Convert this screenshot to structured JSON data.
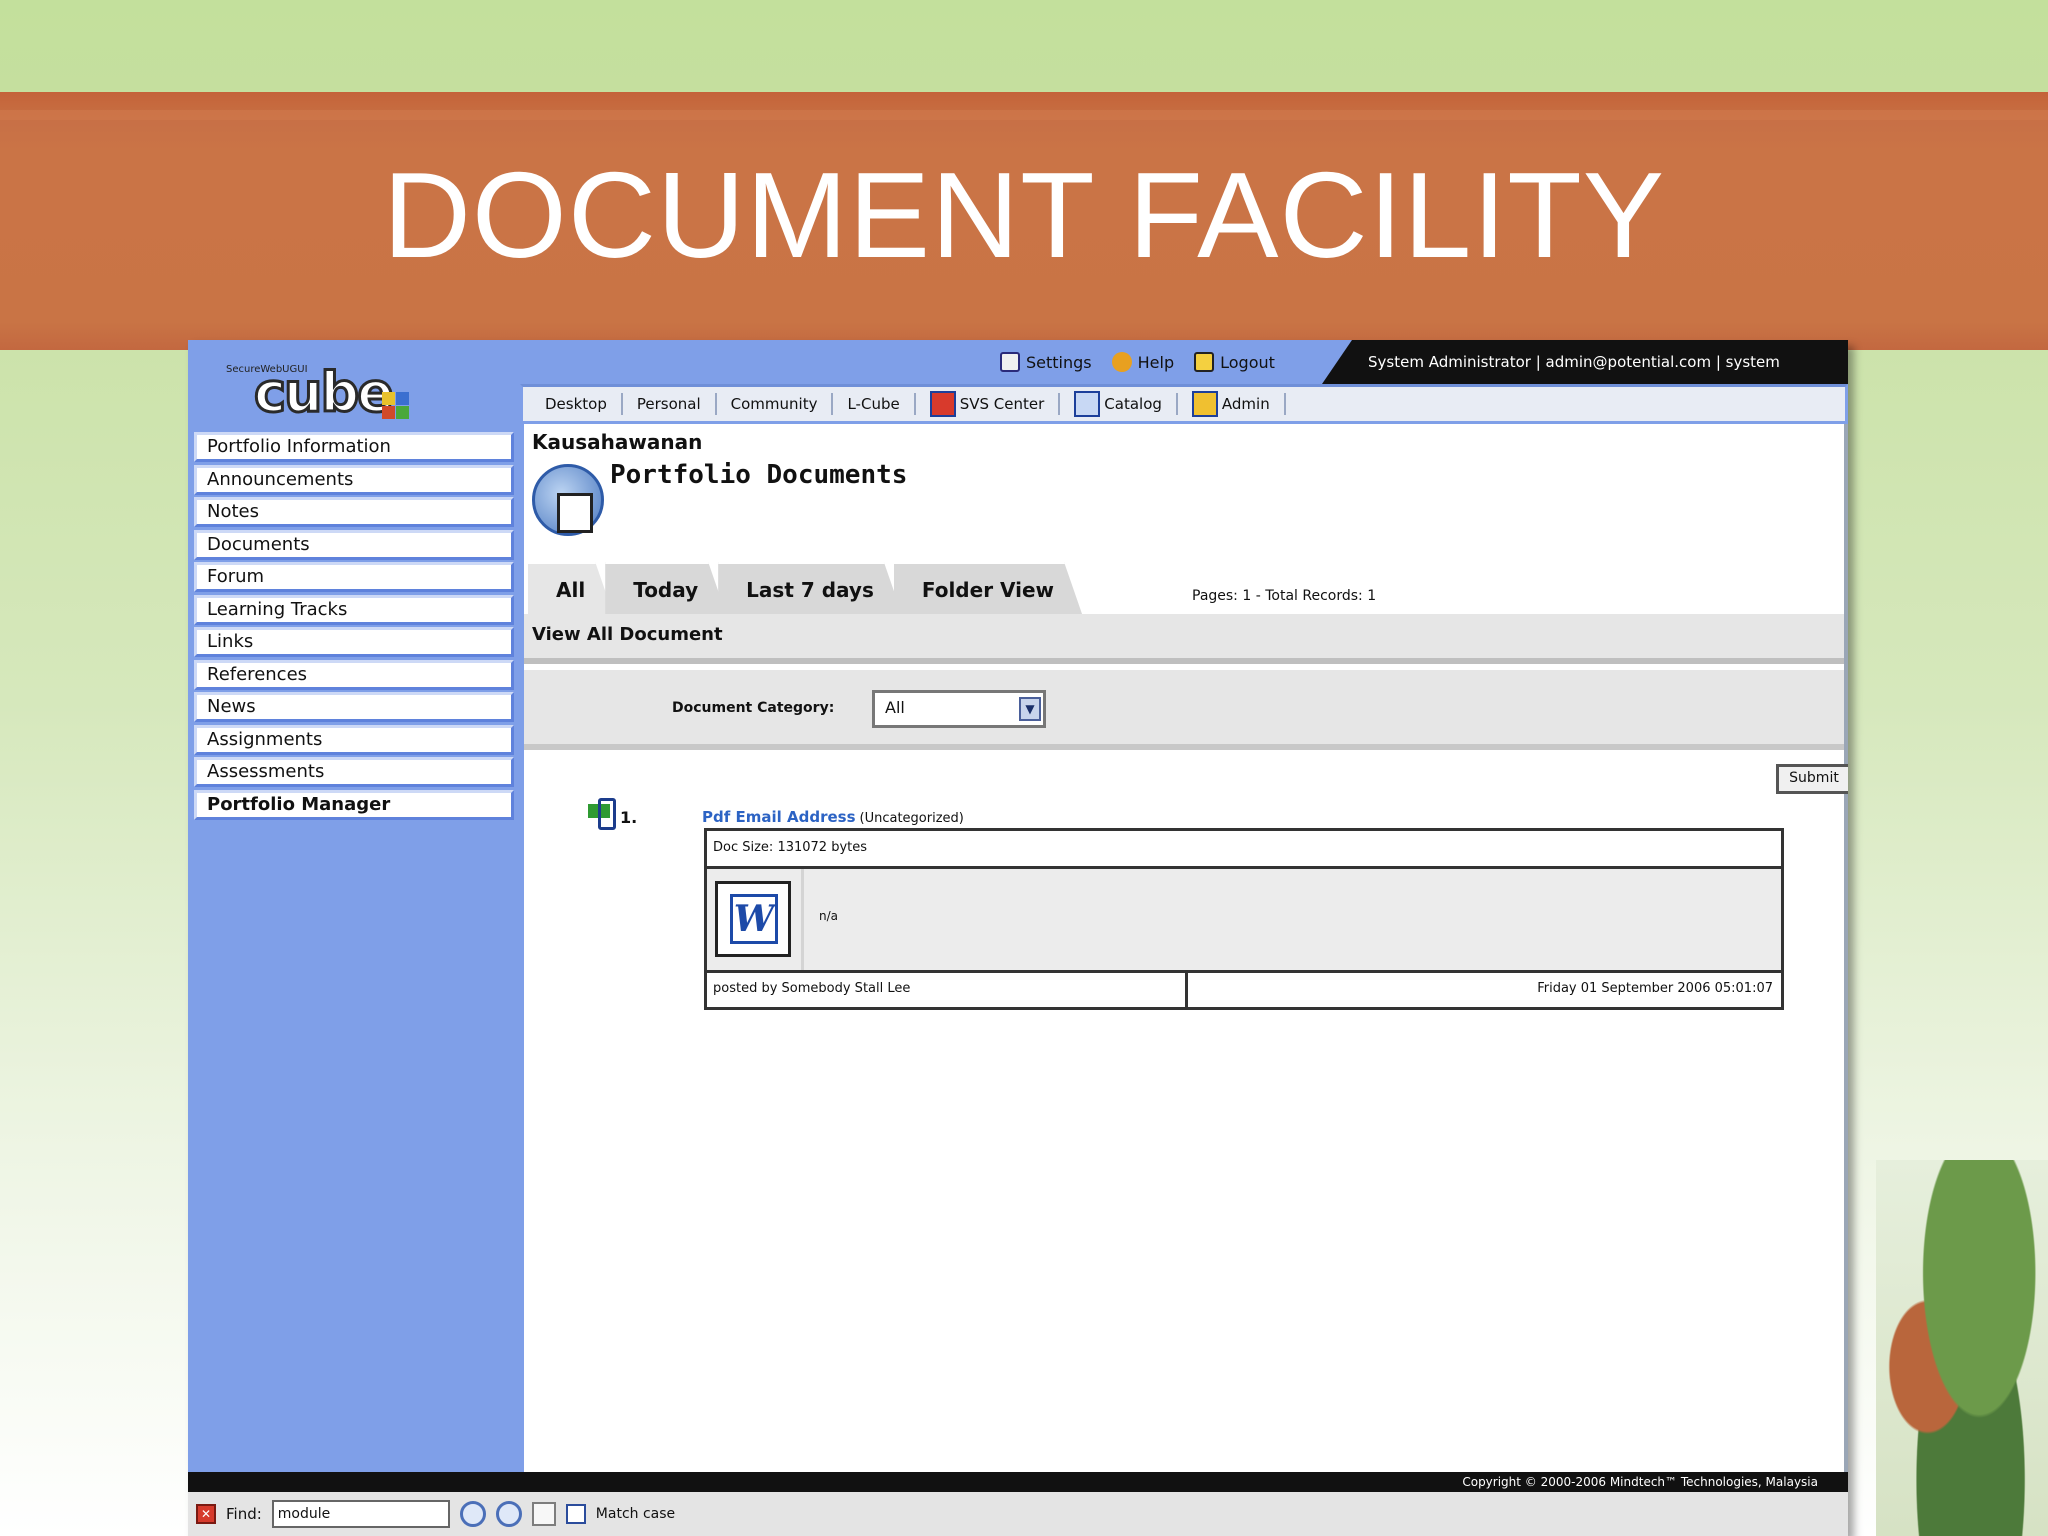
{
  "slide": {
    "title": "DOCUMENT FACILITY"
  },
  "app": {
    "logo_small": "SecureWebUGUI",
    "logo_text": "cube",
    "toplinks": [
      {
        "label": "Settings",
        "icon": "settings-icon"
      },
      {
        "label": "Help",
        "icon": "help-icon"
      },
      {
        "label": "Logout",
        "icon": "logout-icon"
      }
    ],
    "user_info": "System Administrator | admin@potential.com | system"
  },
  "nav": {
    "items": [
      {
        "label": "Desktop"
      },
      {
        "label": "Personal"
      },
      {
        "label": "Community"
      },
      {
        "label": "L-Cube"
      },
      {
        "label": "SVS Center",
        "icon": "svs-icon"
      },
      {
        "label": "Catalog",
        "icon": "catalog-icon"
      },
      {
        "label": "Admin",
        "icon": "admin-icon"
      }
    ]
  },
  "sidebar": {
    "items": [
      {
        "label": "Portfolio Information"
      },
      {
        "label": "Announcements"
      },
      {
        "label": "Notes"
      },
      {
        "label": "Documents"
      },
      {
        "label": "Forum"
      },
      {
        "label": "Learning Tracks"
      },
      {
        "label": "Links"
      },
      {
        "label": "References"
      },
      {
        "label": "News"
      },
      {
        "label": "Assignments"
      },
      {
        "label": "Assessments"
      },
      {
        "label": "Portfolio Manager"
      }
    ]
  },
  "main": {
    "breadcrumb": "Kausahawanan",
    "page_title": "Portfolio Documents",
    "tabs": [
      {
        "label": "All"
      },
      {
        "label": "Today"
      },
      {
        "label": "Last 7 days"
      },
      {
        "label": "Folder View"
      }
    ],
    "paging": "Pages: 1 - Total Records: 1",
    "section_title": "View All Document",
    "filter_label": "Document Category:",
    "filter_value": "All",
    "submit_label": "Submit",
    "document": {
      "number": "1.",
      "title": "Pdf Email Address",
      "category": "(Uncategorized)",
      "size": "Doc Size: 131072 bytes",
      "description": "n/a",
      "posted_by": "posted by Somebody Stall Lee",
      "date": "Friday 01 September 2006 05:01:07"
    }
  },
  "footer": {
    "copyright": "Copyright © 2000-2006 Mindtech™ Technologies, Malaysia"
  },
  "findbar": {
    "label": "Find:",
    "value": "module",
    "match_case": "Match case"
  }
}
